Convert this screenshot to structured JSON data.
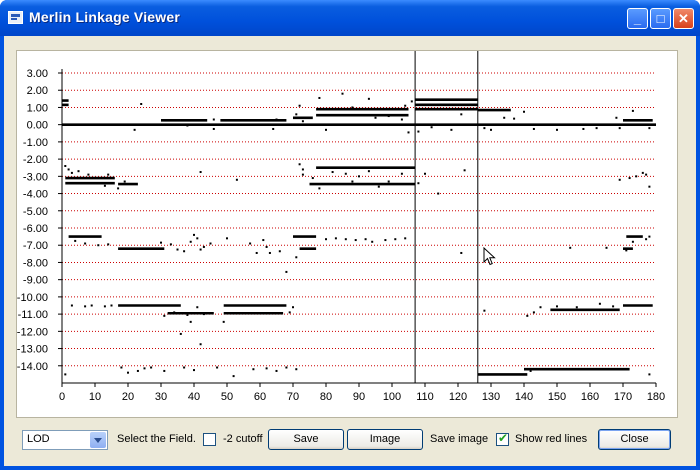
{
  "window": {
    "title": "Merlin Linkage Viewer",
    "minimize_glyph": "_",
    "maximize_glyph": "□",
    "close_glyph": "✕"
  },
  "controls": {
    "field_select_value": "LOD",
    "field_select_label": "Select the Field.",
    "cutoff_label": "-2 cutoff",
    "cutoff_checked": false,
    "save_button": "Save",
    "image_button": "Image",
    "save_image_label": "Save image",
    "show_red_lines_label": "Show red lines",
    "show_red_lines_checked": true,
    "close_button": "Close"
  },
  "chart_data": {
    "type": "scatter",
    "title": "",
    "xlabel": "",
    "ylabel": "",
    "xlim": [
      0,
      180
    ],
    "ylim": [
      -15,
      3
    ],
    "x_ticks": [
      0,
      10,
      20,
      30,
      40,
      50,
      60,
      70,
      80,
      90,
      100,
      110,
      120,
      130,
      140,
      150,
      160,
      170,
      180
    ],
    "y_ticks": [
      3,
      2,
      1,
      0,
      -1,
      -2,
      -3,
      -4,
      -5,
      -6,
      -7,
      -8,
      -9,
      -10,
      -11,
      -12,
      -13,
      -14
    ],
    "y_tick_labels": [
      "3.00",
      "2.00",
      "1.00",
      "0.00",
      "-1.00",
      "-2.00",
      "-3.00",
      "-4.00",
      "-5.00",
      "-6.00",
      "-7.00",
      "-8.00",
      "-9.00",
      "-10.00",
      "-11.00",
      "-12.00",
      "-13.00",
      "-14.00"
    ],
    "red_gridlines": true,
    "vertical_markers": [
      107,
      126
    ],
    "colors": {
      "points": "#000000",
      "gridlines": "#cc0000",
      "markers": "#000000"
    },
    "segments": [
      {
        "x0": 0,
        "x1": 180,
        "y": 0.0
      },
      {
        "x0": 0,
        "x1": 2,
        "y": 1.4
      },
      {
        "x0": 0,
        "x1": 2,
        "y": 1.15
      },
      {
        "x0": 107,
        "x1": 126,
        "y": 1.45
      },
      {
        "x0": 107,
        "x1": 126,
        "y": 1.15
      },
      {
        "x0": 107,
        "x1": 126,
        "y": 0.9
      },
      {
        "x0": 30,
        "x1": 44,
        "y": 0.25
      },
      {
        "x0": 48,
        "x1": 68,
        "y": 0.25
      },
      {
        "x0": 70,
        "x1": 76,
        "y": 0.4
      },
      {
        "x0": 77,
        "x1": 105,
        "y": 0.9
      },
      {
        "x0": 77,
        "x1": 105,
        "y": 0.55
      },
      {
        "x0": 126,
        "x1": 136,
        "y": 0.85
      },
      {
        "x0": 170,
        "x1": 179,
        "y": 0.25
      },
      {
        "x0": 1,
        "x1": 16,
        "y": -3.1
      },
      {
        "x0": 1,
        "x1": 16,
        "y": -3.4
      },
      {
        "x0": 17,
        "x1": 23,
        "y": -3.45
      },
      {
        "x0": 77,
        "x1": 107,
        "y": -2.5
      },
      {
        "x0": 75,
        "x1": 107,
        "y": -3.45
      },
      {
        "x0": 2,
        "x1": 12,
        "y": -6.5
      },
      {
        "x0": 17,
        "x1": 31,
        "y": -7.2
      },
      {
        "x0": 70,
        "x1": 77,
        "y": -6.5
      },
      {
        "x0": 72,
        "x1": 77,
        "y": -7.2
      },
      {
        "x0": 171,
        "x1": 176,
        "y": -6.5
      },
      {
        "x0": 170,
        "x1": 173,
        "y": -7.2
      },
      {
        "x0": 17,
        "x1": 36,
        "y": -10.5
      },
      {
        "x0": 32,
        "x1": 46,
        "y": -10.95
      },
      {
        "x0": 49,
        "x1": 68,
        "y": -10.5
      },
      {
        "x0": 49,
        "x1": 67,
        "y": -10.95
      },
      {
        "x0": 148,
        "x1": 169,
        "y": -10.75
      },
      {
        "x0": 170,
        "x1": 179,
        "y": -10.5
      },
      {
        "x0": 126,
        "x1": 141,
        "y": -14.5
      },
      {
        "x0": 140,
        "x1": 172,
        "y": -14.2
      }
    ],
    "points": [
      [
        1,
        -2.4
      ],
      [
        2,
        -2.6
      ],
      [
        3,
        -2.8
      ],
      [
        5,
        -2.7
      ],
      [
        8,
        -2.9
      ],
      [
        14,
        -2.9
      ],
      [
        17,
        -3.7
      ],
      [
        19,
        -3.3
      ],
      [
        13,
        -3.55
      ],
      [
        22,
        -0.3
      ],
      [
        24,
        1.2
      ],
      [
        38,
        -0.05
      ],
      [
        42,
        -2.75
      ],
      [
        46,
        -0.25
      ],
      [
        46,
        0.3
      ],
      [
        53,
        -3.2
      ],
      [
        64,
        -0.25
      ],
      [
        65,
        0.3
      ],
      [
        71,
        0.6
      ],
      [
        72,
        1.1
      ],
      [
        73,
        0.2
      ],
      [
        78,
        1.55
      ],
      [
        80,
        -0.3
      ],
      [
        85,
        1.8
      ],
      [
        88,
        1.0
      ],
      [
        93,
        1.5
      ],
      [
        95,
        0.4
      ],
      [
        99,
        0.5
      ],
      [
        103,
        0.3
      ],
      [
        104,
        1.1
      ],
      [
        106,
        1.35
      ],
      [
        105,
        -0.45
      ],
      [
        108,
        -0.4
      ],
      [
        112,
        -0.15
      ],
      [
        118,
        -0.3
      ],
      [
        121,
        0.6
      ],
      [
        128,
        -0.2
      ],
      [
        130,
        -0.3
      ],
      [
        134,
        0.4
      ],
      [
        137,
        0.35
      ],
      [
        140,
        0.75
      ],
      [
        143,
        -0.25
      ],
      [
        150,
        -0.3
      ],
      [
        158,
        -0.25
      ],
      [
        162,
        -0.2
      ],
      [
        168,
        0.4
      ],
      [
        169,
        -0.2
      ],
      [
        173,
        0.8
      ],
      [
        178,
        -0.2
      ],
      [
        72,
        -2.3
      ],
      [
        73,
        -2.6
      ],
      [
        73,
        -2.9
      ],
      [
        76,
        -3.1
      ],
      [
        78,
        -3.7
      ],
      [
        82,
        -2.75
      ],
      [
        86,
        -2.85
      ],
      [
        88,
        -3.3
      ],
      [
        90,
        -3.0
      ],
      [
        93,
        -2.7
      ],
      [
        96,
        -3.6
      ],
      [
        99,
        -3.3
      ],
      [
        103,
        -2.85
      ],
      [
        108,
        -3.4
      ],
      [
        110,
        -2.85
      ],
      [
        114,
        -4.0
      ],
      [
        122,
        -2.65
      ],
      [
        169,
        -3.2
      ],
      [
        172,
        -3.1
      ],
      [
        174,
        -3.0
      ],
      [
        176,
        -2.8
      ],
      [
        177,
        -2.9
      ],
      [
        178,
        -3.6
      ],
      [
        4,
        -6.75
      ],
      [
        7,
        -6.9
      ],
      [
        11,
        -7.0
      ],
      [
        14,
        -6.95
      ],
      [
        30,
        -6.85
      ],
      [
        33,
        -6.95
      ],
      [
        35,
        -7.25
      ],
      [
        37,
        -7.35
      ],
      [
        39,
        -6.8
      ],
      [
        40,
        -6.4
      ],
      [
        41,
        -6.6
      ],
      [
        42,
        -7.25
      ],
      [
        43,
        -7.1
      ],
      [
        45,
        -6.9
      ],
      [
        50,
        -6.6
      ],
      [
        57,
        -6.9
      ],
      [
        59,
        -7.45
      ],
      [
        61,
        -6.7
      ],
      [
        62,
        -7.1
      ],
      [
        63,
        -7.45
      ],
      [
        66,
        -7.35
      ],
      [
        68,
        -8.55
      ],
      [
        71,
        -7.7
      ],
      [
        80,
        -6.65
      ],
      [
        83,
        -6.6
      ],
      [
        86,
        -6.65
      ],
      [
        89,
        -6.7
      ],
      [
        92,
        -6.65
      ],
      [
        94,
        -6.8
      ],
      [
        98,
        -6.7
      ],
      [
        101,
        -6.65
      ],
      [
        104,
        -6.6
      ],
      [
        121,
        -7.45
      ],
      [
        154,
        -7.15
      ],
      [
        165,
        -7.15
      ],
      [
        171,
        -7.3
      ],
      [
        173,
        -6.8
      ],
      [
        177,
        -6.65
      ],
      [
        178,
        -6.5
      ],
      [
        3,
        -10.5
      ],
      [
        7,
        -10.55
      ],
      [
        9,
        -10.5
      ],
      [
        13,
        -10.55
      ],
      [
        15,
        -10.5
      ],
      [
        31,
        -11.1
      ],
      [
        34,
        -10.9
      ],
      [
        38,
        -11.05
      ],
      [
        41,
        -10.6
      ],
      [
        43,
        -11.0
      ],
      [
        69,
        -10.9
      ],
      [
        70,
        -10.6
      ],
      [
        128,
        -10.8
      ],
      [
        141,
        -11.1
      ],
      [
        143,
        -10.9
      ],
      [
        145,
        -10.6
      ],
      [
        150,
        -10.55
      ],
      [
        156,
        -10.6
      ],
      [
        163,
        -10.4
      ],
      [
        167,
        -10.55
      ],
      [
        36,
        -12.15
      ],
      [
        39,
        -11.45
      ],
      [
        49,
        -11.45
      ],
      [
        42,
        -12.75
      ],
      [
        1,
        -14.5
      ],
      [
        18,
        -14.1
      ],
      [
        20,
        -14.4
      ],
      [
        23,
        -14.3
      ],
      [
        25,
        -14.15
      ],
      [
        27,
        -14.1
      ],
      [
        31,
        -14.3
      ],
      [
        37,
        -14.1
      ],
      [
        40,
        -14.25
      ],
      [
        47,
        -14.1
      ],
      [
        52,
        -14.6
      ],
      [
        58,
        -14.2
      ],
      [
        62,
        -14.15
      ],
      [
        65,
        -14.3
      ],
      [
        68,
        -14.1
      ],
      [
        71,
        -14.2
      ],
      [
        142,
        -14.3
      ],
      [
        145,
        -14.2
      ],
      [
        178,
        -14.5
      ]
    ]
  }
}
